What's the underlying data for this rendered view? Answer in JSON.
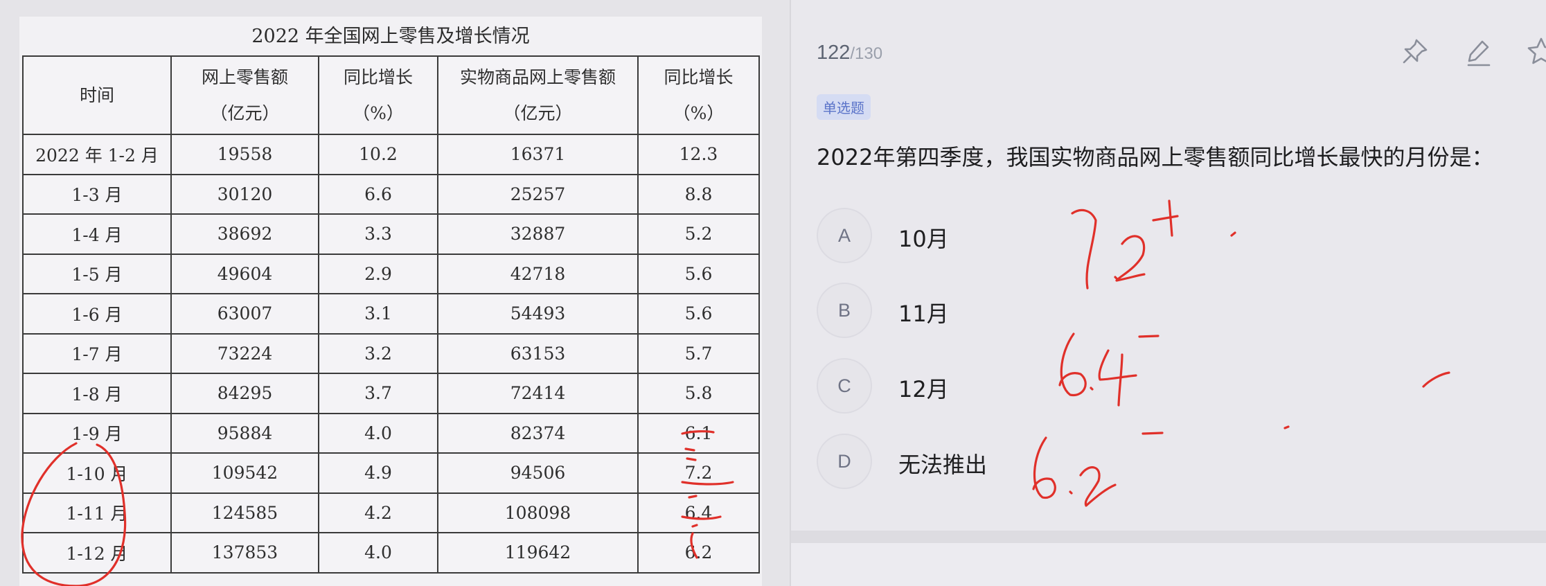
{
  "table": {
    "title": "2022 年全国网上零售及增长情况",
    "headers": [
      [
        "时间"
      ],
      [
        "网上零售额",
        "（亿元）"
      ],
      [
        "同比增长",
        "（%）"
      ],
      [
        "实物商品网上零售额",
        "（亿元）"
      ],
      [
        "同比增长",
        "（%）"
      ]
    ],
    "rows": [
      [
        "2022 年 1-2 月",
        "19558",
        "10.2",
        "16371",
        "12.3"
      ],
      [
        "1-3 月",
        "30120",
        "6.6",
        "25257",
        "8.8"
      ],
      [
        "1-4 月",
        "38692",
        "3.3",
        "32887",
        "5.2"
      ],
      [
        "1-5 月",
        "49604",
        "2.9",
        "42718",
        "5.6"
      ],
      [
        "1-6 月",
        "63007",
        "3.1",
        "54493",
        "5.6"
      ],
      [
        "1-7 月",
        "73224",
        "3.2",
        "63153",
        "5.7"
      ],
      [
        "1-8 月",
        "84295",
        "3.7",
        "72414",
        "5.8"
      ],
      [
        "1-9 月",
        "95884",
        "4.0",
        "82374",
        "6.1"
      ],
      [
        "1-10 月",
        "109542",
        "4.9",
        "94506",
        "7.2"
      ],
      [
        "1-11 月",
        "124585",
        "4.2",
        "108098",
        "6.4"
      ],
      [
        "1-12 月",
        "137853",
        "4.0",
        "119642",
        "6.2"
      ]
    ]
  },
  "question": {
    "counter_current": "122",
    "counter_total": "/130",
    "type_badge": "单选题",
    "text": "2022年第四季度，我国实物商品网上零售额同比增长最快的月份是：",
    "options": [
      {
        "letter": "A",
        "text": "10月"
      },
      {
        "letter": "B",
        "text": "11月"
      },
      {
        "letter": "C",
        "text": "12月"
      },
      {
        "letter": "D",
        "text": "无法推出"
      }
    ]
  },
  "toolbar": {
    "icons": [
      "pin-icon",
      "edit-icon",
      "star-icon"
    ]
  },
  "handwriting": {
    "notes": [
      "7.2",
      "6.4",
      "6.2"
    ],
    "color": "#e0302a"
  }
}
